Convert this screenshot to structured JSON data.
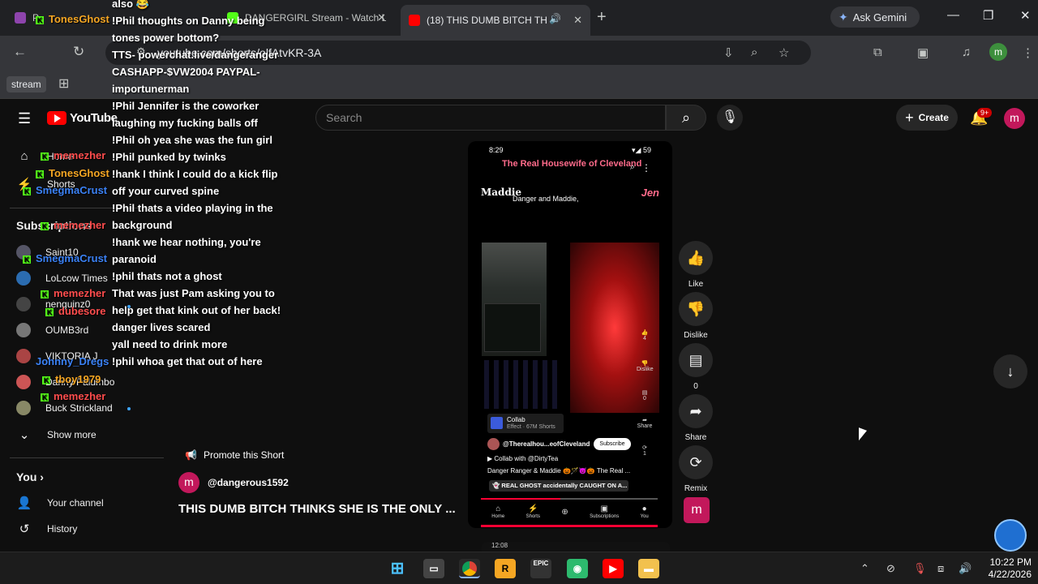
{
  "browser": {
    "tabs": [
      {
        "title": "P",
        "favicon": "#8e44ad"
      },
      {
        "title": "DANGERGIRL Stream - Watch Liv",
        "favicon": "#53fc18"
      },
      {
        "title": "(18) THIS DUMB BITCH THI",
        "favicon": "#ff0000"
      }
    ],
    "ask_gemini": "Ask Gemini",
    "url": "youtube.com/shorts/olfAtvKR-3A",
    "bookmark": "stream"
  },
  "youtube": {
    "logo_text": "YouTube",
    "search_placeholder": "Search",
    "create_label": "Create",
    "notif_badge": "9+",
    "avatar_letter": "m",
    "sidebar": {
      "home": "Home",
      "shorts": "Shorts",
      "subscriptions_heading": "Subscriptions",
      "subscriptions": [
        "Saint10",
        "LoLcow Times",
        "nenguinz0",
        "OUMB3rd",
        "VIKTORIA J",
        "Danny Palumbo",
        "Buck Strickland"
      ],
      "show_more": "Show more",
      "you_heading": "You",
      "your_channel": "Your channel",
      "history": "History"
    }
  },
  "chat_overlay": {
    "lines": [
      "also 😂",
      "!Phil thoughts on Danny being tones power bottom?",
      "TTS- powerchat.live/dangeranger CASHAPP-$VW2004 PAYPAL-importunerman",
      "!Phil Jennifer is the coworker laughing my fucking balls off",
      "!Phil oh yea she was the fun girl",
      "!Phil punked by twinks",
      "!hank I think I could do a kick flip off your curved spine",
      "!Phil thats a video playing in the background",
      "!hank we hear nothing, you're paranoid",
      "!phil thats not a ghost",
      "That was just Pam asking you to help get that kink out of her back!",
      "danger lives scared",
      "yall need to drink more",
      "!phil whoa get that out of here"
    ],
    "usernames": [
      {
        "name": "TonesGhost",
        "color": "#f5a623"
      },
      {
        "name": "memezher",
        "color": "#ff4d4d"
      },
      {
        "name": "TonesGhost",
        "color": "#f5a623"
      },
      {
        "name": "SmegmaCrust",
        "color": "#3b82f6"
      },
      {
        "name": "memezher",
        "color": "#ff4d4d"
      },
      {
        "name": "SmegmaCrust",
        "color": "#3b82f6"
      },
      {
        "name": "memezher",
        "color": "#ff4d4d"
      },
      {
        "name": "dubesore",
        "color": "#ff4d4d"
      },
      {
        "name": "Johnny_Dregs",
        "color": "#3b82f6"
      },
      {
        "name": "tboy1979",
        "color": "#f5a623"
      },
      {
        "name": "memezher",
        "color": "#ff4d4d"
      }
    ]
  },
  "short": {
    "status_time": "8:29",
    "status_battery": "59",
    "show_title": "The Real Housewife of Cleveland",
    "maddie": "Maddie",
    "danger_caption": "Danger and Maddie,",
    "jen": "Jen",
    "collab_label": "Collab",
    "collab_sub": "Effect · 67M Shorts",
    "inner_channel": "@Therealhou...eofCleveland",
    "inner_subscribe": "Subscribe",
    "collab_with": "Collab with @DirtyTea",
    "inner_desc": "Danger Ranger & Maddie 🎃🪄😈🎃 The Real ...",
    "ghost_chip": "👻 REAL GHOST accidentally CAUGHT ON A...",
    "inner_like_count": "4",
    "inner_dislike": "Dislike",
    "inner_comment_count": "0",
    "inner_share": "Share",
    "inner_remix_count": "1",
    "progress": 0.45,
    "nav": [
      "Home",
      "Shorts",
      "Subscriptions",
      "You"
    ],
    "next_time": "12:08"
  },
  "actions": {
    "like": "Like",
    "dislike": "Dislike",
    "comments": "0",
    "share": "Share",
    "remix": "Remix"
  },
  "info": {
    "promote": "Promote this Short",
    "channel": "@dangerous1592",
    "title": "THIS DUMB BITCH THINKS SHE IS THE ONLY ..."
  },
  "taskbar": {
    "time": "10:22 PM",
    "date": "4/22/2026"
  }
}
